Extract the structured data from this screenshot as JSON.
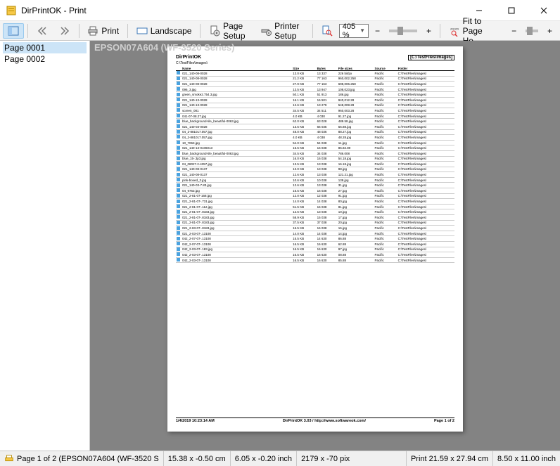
{
  "window": {
    "title": "DirPrintOK - Print"
  },
  "toolbar": {
    "print": "Print",
    "landscape": "Landscape",
    "page_setup": "Page Setup",
    "printer_setup": "Printer Setup",
    "zoom_value": "405 %",
    "fit_label": "Fit to Page He..."
  },
  "sidebar": {
    "pages": [
      "Page 0001",
      "Page 0002"
    ]
  },
  "preview": {
    "printer_label": "EPSON07A604 (WF-3520 Series)",
    "page": {
      "title": "DirPrintOK",
      "path_box": "[C:\\TestFiles\\images]",
      "subpath": "C:\\TestFiles\\images\\",
      "headers": [
        "",
        "Name",
        "Size",
        "Bytes",
        "File sizes",
        "Source",
        "Folder"
      ],
      "rows": [
        [
          "021_140-08-0028",
          "13.0 KB",
          "13 337",
          "226 bit/px",
          "Pacific",
          "C:\\TestFiles\\images\\"
        ],
        [
          "021_140-08-0028",
          "21.2 KB",
          "77 163",
          "960,002.258",
          "Pacific",
          "C:\\TestFiles\\images\\"
        ],
        [
          "021_140-08-0028",
          "27.9 KB",
          "77 163",
          "698,006.258",
          "Pacific",
          "C:\\TestFiles\\images\\"
        ],
        [
          "096_3.jpg",
          "13.5 KB",
          "13 947",
          "108,023.jpg",
          "Pacific",
          "C:\\TestFiles\\images\\"
        ],
        [
          "green_smoke2.754.3.jpg",
          "50.1 KB",
          "51 913",
          "186.jpg",
          "Pacific",
          "C:\\TestFiles\\images\\"
        ],
        [
          "021_140-13-0028",
          "16.1 KB",
          "16 501",
          "940,012.28",
          "Pacific",
          "C:\\TestFiles\\images\\"
        ],
        [
          "021_140-13-0028",
          "12.6 KB",
          "13 279",
          "548,008.28",
          "Pacific",
          "C:\\TestFiles\\images\\"
        ],
        [
          "screen_081",
          "34.5 KB",
          "34 511",
          "960,003.28",
          "Pacific",
          "C:\\TestFiles\\images\\"
        ],
        [
          "041-07-08.27.jpg",
          "4.0 KB",
          "4 030",
          "91.27.jpg",
          "Pacific",
          "C:\\TestFiles\\images\\"
        ],
        [
          "blue_background-tile_beautiful-0063.jpg",
          "62.0 KB",
          "63 028",
          "489.58.jpg",
          "Pacific",
          "C:\\TestFiles\\images\\"
        ],
        [
          "021_140-03-0028",
          "13.5 KB",
          "66 035",
          "56.88.jpg",
          "Pacific",
          "C:\\TestFiles\\images\\"
        ],
        [
          "04_2-881017.057.jpg",
          "48.0 KB",
          "48 036",
          "88.27.jpg",
          "Pacific",
          "C:\\TestFiles\\images\\"
        ],
        [
          "04_2-881017.057.jpg",
          "4.0 KB",
          "4 038",
          "48.28.jpg",
          "Pacific",
          "C:\\TestFiles\\images\\"
        ],
        [
          "10_7063.jpg",
          "54.0 KB",
          "54 038",
          "11.jpg",
          "Pacific",
          "C:\\TestFiles\\images\\"
        ],
        [
          "021_140-13-0106013",
          "15.5 KB",
          "16 038",
          "86.82.80",
          "Pacific",
          "C:\\TestFiles\\images\\"
        ],
        [
          "blue_background-tile_beautiful-0063.jpg",
          "34.5 KB",
          "34 038",
          "786.008",
          "Pacific",
          "C:\\TestFiles\\images\\"
        ],
        [
          "blue_15-.3p3.jpg",
          "16.0 KB",
          "16 038",
          "54.18.jpg",
          "Pacific",
          "C:\\TestFiles\\images\\"
        ],
        [
          "04_08027.2-4357.jpg",
          "13.5 KB",
          "13 038",
          "16.18.jpg",
          "Pacific",
          "C:\\TestFiles\\images\\"
        ],
        [
          "021_140-08-0137",
          "13.0 KB",
          "13 038",
          "98.jpg",
          "Pacific",
          "C:\\TestFiles\\images\\"
        ],
        [
          "021_140-08-0137",
          "12.6 KB",
          "13 038",
          "121.21.jpg",
          "Pacific",
          "C:\\TestFiles\\images\\"
        ],
        [
          "pink-boxed_3.jpg",
          "10.6 KB",
          "10 038",
          "138.jpg",
          "Pacific",
          "C:\\TestFiles\\images\\"
        ],
        [
          "021_140-03-7.83.jpg",
          "12.6 KB",
          "13 038",
          "31.jpg",
          "Pacific",
          "C:\\TestFiles\\images\\"
        ],
        [
          "04_9763.jpg",
          "15.5 KB",
          "16 038",
          "27.jpg",
          "Pacific",
          "C:\\TestFiles\\images\\"
        ],
        [
          "021_2-81-07-168.jpg",
          "12.0 KB",
          "12 038",
          "91.jpg",
          "Pacific",
          "C:\\TestFiles\\images\\"
        ],
        [
          "021_2-81-07-.731.jpg",
          "14.0 KB",
          "14 038",
          "80.jpg",
          "Pacific",
          "C:\\TestFiles\\images\\"
        ],
        [
          "021_2-81-07-.112.jpg",
          "51.5 KB",
          "15 038",
          "81.jpg",
          "Pacific",
          "C:\\TestFiles\\images\\"
        ],
        [
          "021_2-81-07-.8183.jpg",
          "12.6 KB",
          "13 038",
          "10.jpg",
          "Pacific",
          "C:\\TestFiles\\images\\"
        ],
        [
          "021_2-81-07-.8183.jpg",
          "58.9 KB",
          "15 038",
          "17.jpg",
          "Pacific",
          "C:\\TestFiles\\images\\"
        ],
        [
          "021_2-81-07-.8183.jpg",
          "37.5 KB",
          "37 038",
          "20.jpg",
          "Pacific",
          "C:\\TestFiles\\images\\"
        ],
        [
          "021_2-83-07-.8183.jpg",
          "16.5 KB",
          "16 038",
          "16.jpg",
          "Pacific",
          "C:\\TestFiles\\images\\"
        ],
        [
          "021_2-03-07-.13108",
          "14.0 KB",
          "14 038",
          "14.jpg",
          "Pacific",
          "C:\\TestFiles\\images\\"
        ],
        [
          "042_2-07-07-.13108",
          "15.5 KB",
          "14 630",
          "86.88",
          "Pacific",
          "C:\\TestFiles\\images\\"
        ],
        [
          "042_2-07-07-.13108",
          "16.5 KB",
          "16 630",
          "62.88",
          "Pacific",
          "C:\\TestFiles\\images\\"
        ],
        [
          "042_2-03-07-.183.jpg",
          "16.5 KB",
          "16 630",
          "97.jpg",
          "Pacific",
          "C:\\TestFiles\\images\\"
        ],
        [
          "042_2-03-07-.13108",
          "16.5 KB",
          "16 630",
          "08.88",
          "Pacific",
          "C:\\TestFiles\\images\\"
        ],
        [
          "042_2-03-07-.13108",
          "16.5 KB",
          "16 630",
          "85.88",
          "Pacific",
          "C:\\TestFiles\\images\\"
        ]
      ],
      "footer_left": "1/4/2019 10:23:14 AM",
      "footer_mid": "DirPrintOK 3.03 / http://www.softwareok.com/",
      "footer_right": "Page 1 of 2"
    }
  },
  "status": {
    "page_info": "Page 1 of 2 (EPSON07A604 (WF-3520 S",
    "cm": "15.38 x -0.50 cm",
    "inch": "6.05 x -0.20 inch",
    "pix": "2179 x -70 pix",
    "print_cm": "Print 21.59 x 27.94 cm",
    "print_in": "8.50 x 11.00 inch"
  }
}
